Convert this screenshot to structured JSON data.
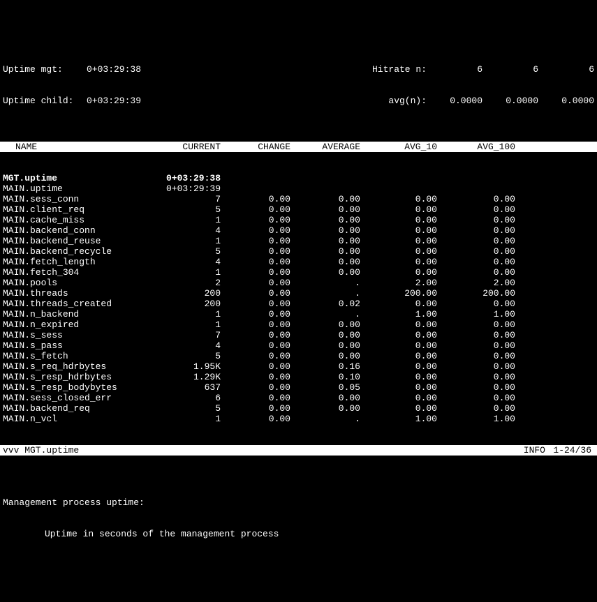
{
  "top": {
    "mgt_label": "Uptime mgt:",
    "mgt_value": "0+03:29:38",
    "child_label": "Uptime child:",
    "child_value": "0+03:29:39",
    "hitrate_label": "Hitrate n:",
    "hitrate_v1": "6",
    "hitrate_v2": "6",
    "hitrate_v3": "6",
    "avgn_label": "avg(n):",
    "avgn_v1": "0.0000",
    "avgn_v2": "0.0000",
    "avgn_v3": "0.0000"
  },
  "headers": {
    "name": "NAME",
    "current": "CURRENT",
    "change": "CHANGE",
    "average": "AVERAGE",
    "avg10": "AVG_10",
    "avg100": "AVG_100"
  },
  "rows": [
    {
      "name": "MGT.uptime",
      "cur": "0+03:29:38",
      "chg": "",
      "avg": "",
      "a10": "",
      "a100": "",
      "hl": true
    },
    {
      "name": "MAIN.uptime",
      "cur": "0+03:29:39",
      "chg": "",
      "avg": "",
      "a10": "",
      "a100": ""
    },
    {
      "name": "MAIN.sess_conn",
      "cur": "7",
      "chg": "0.00",
      "avg": "0.00",
      "a10": "0.00",
      "a100": "0.00"
    },
    {
      "name": "MAIN.client_req",
      "cur": "5",
      "chg": "0.00",
      "avg": "0.00",
      "a10": "0.00",
      "a100": "0.00"
    },
    {
      "name": "MAIN.cache_miss",
      "cur": "1",
      "chg": "0.00",
      "avg": "0.00",
      "a10": "0.00",
      "a100": "0.00"
    },
    {
      "name": "MAIN.backend_conn",
      "cur": "4",
      "chg": "0.00",
      "avg": "0.00",
      "a10": "0.00",
      "a100": "0.00"
    },
    {
      "name": "MAIN.backend_reuse",
      "cur": "1",
      "chg": "0.00",
      "avg": "0.00",
      "a10": "0.00",
      "a100": "0.00"
    },
    {
      "name": "MAIN.backend_recycle",
      "cur": "5",
      "chg": "0.00",
      "avg": "0.00",
      "a10": "0.00",
      "a100": "0.00"
    },
    {
      "name": "MAIN.fetch_length",
      "cur": "4",
      "chg": "0.00",
      "avg": "0.00",
      "a10": "0.00",
      "a100": "0.00"
    },
    {
      "name": "MAIN.fetch_304",
      "cur": "1",
      "chg": "0.00",
      "avg": "0.00",
      "a10": "0.00",
      "a100": "0.00"
    },
    {
      "name": "MAIN.pools",
      "cur": "2",
      "chg": "0.00",
      "avg": ".",
      "a10": "2.00",
      "a100": "2.00"
    },
    {
      "name": "MAIN.threads",
      "cur": "200",
      "chg": "0.00",
      "avg": ".",
      "a10": "200.00",
      "a100": "200.00"
    },
    {
      "name": "MAIN.threads_created",
      "cur": "200",
      "chg": "0.00",
      "avg": "0.02",
      "a10": "0.00",
      "a100": "0.00"
    },
    {
      "name": "MAIN.n_backend",
      "cur": "1",
      "chg": "0.00",
      "avg": ".",
      "a10": "1.00",
      "a100": "1.00"
    },
    {
      "name": "MAIN.n_expired",
      "cur": "1",
      "chg": "0.00",
      "avg": "0.00",
      "a10": "0.00",
      "a100": "0.00"
    },
    {
      "name": "MAIN.s_sess",
      "cur": "7",
      "chg": "0.00",
      "avg": "0.00",
      "a10": "0.00",
      "a100": "0.00"
    },
    {
      "name": "MAIN.s_pass",
      "cur": "4",
      "chg": "0.00",
      "avg": "0.00",
      "a10": "0.00",
      "a100": "0.00"
    },
    {
      "name": "MAIN.s_fetch",
      "cur": "5",
      "chg": "0.00",
      "avg": "0.00",
      "a10": "0.00",
      "a100": "0.00"
    },
    {
      "name": "MAIN.s_req_hdrbytes",
      "cur": "1.95K",
      "chg": "0.00",
      "avg": "0.16",
      "a10": "0.00",
      "a100": "0.00"
    },
    {
      "name": "MAIN.s_resp_hdrbytes",
      "cur": "1.29K",
      "chg": "0.00",
      "avg": "0.10",
      "a10": "0.00",
      "a100": "0.00"
    },
    {
      "name": "MAIN.s_resp_bodybytes",
      "cur": "637",
      "chg": "0.00",
      "avg": "0.05",
      "a10": "0.00",
      "a100": "0.00"
    },
    {
      "name": "MAIN.sess_closed_err",
      "cur": "6",
      "chg": "0.00",
      "avg": "0.00",
      "a10": "0.00",
      "a100": "0.00"
    },
    {
      "name": "MAIN.backend_req",
      "cur": "5",
      "chg": "0.00",
      "avg": "0.00",
      "a10": "0.00",
      "a100": "0.00"
    },
    {
      "name": "MAIN.n_vcl",
      "cur": "1",
      "chg": "0.00",
      "avg": ".",
      "a10": "1.00",
      "a100": "1.00"
    }
  ],
  "footer": {
    "selected": "vvv MGT.uptime",
    "info": "INFO",
    "page": "1-24/36"
  },
  "desc": {
    "title": "Management process uptime:",
    "body": "Uptime in seconds of the management process"
  }
}
